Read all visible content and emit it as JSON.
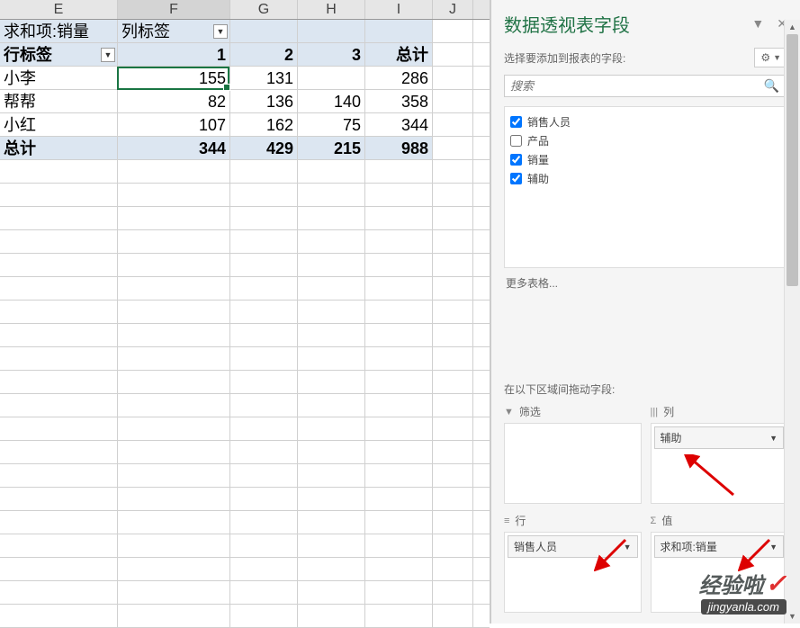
{
  "columns": [
    "E",
    "F",
    "G",
    "H",
    "I",
    "J"
  ],
  "pivot": {
    "sum_label": "求和项:销量",
    "col_labels": "列标签",
    "row_labels": "行标签",
    "headers": [
      "1",
      "2",
      "3",
      "总计"
    ],
    "rows": [
      {
        "label": "小李",
        "vals": [
          "155",
          "131",
          "",
          "286"
        ]
      },
      {
        "label": "帮帮",
        "vals": [
          "82",
          "136",
          "140",
          "358"
        ]
      },
      {
        "label": "小红",
        "vals": [
          "107",
          "162",
          "75",
          "344"
        ]
      }
    ],
    "total_label": "总计",
    "totals": [
      "344",
      "429",
      "215",
      "988"
    ]
  },
  "pane": {
    "title": "数据透视表字段",
    "sub": "选择要添加到报表的字段:",
    "search_placeholder": "搜索",
    "fields": [
      {
        "name": "销售人员",
        "checked": true
      },
      {
        "name": "产品",
        "checked": false
      },
      {
        "name": "销量",
        "checked": true
      },
      {
        "name": "辅助",
        "checked": true
      }
    ],
    "more": "更多表格...",
    "drag": "在以下区域间拖动字段:",
    "zones": {
      "filter": "筛选",
      "columns": "列",
      "rows": "行",
      "values": "值"
    },
    "col_item": "辅助",
    "row_item": "销售人员",
    "val_item": "求和项:销量"
  },
  "watermark": {
    "brand": "经验啦",
    "url": "jingyanla.com"
  }
}
